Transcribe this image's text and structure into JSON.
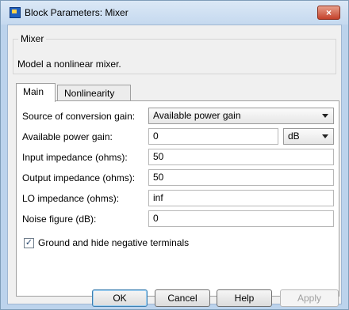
{
  "window": {
    "title": "Block Parameters: Mixer",
    "close_glyph": "×"
  },
  "group": {
    "legend": "Mixer",
    "description": "Model a nonlinear mixer."
  },
  "tabs": [
    {
      "label": "Main"
    },
    {
      "label": "Nonlinearity"
    }
  ],
  "main": {
    "source_gain": {
      "label": "Source of conversion gain:",
      "value": "Available power gain"
    },
    "available_power_gain": {
      "label": "Available power gain:",
      "value": "0",
      "unit": "dB"
    },
    "input_impedance": {
      "label": "Input impedance (ohms):",
      "value": "50"
    },
    "output_impedance": {
      "label": "Output impedance (ohms):",
      "value": "50"
    },
    "lo_impedance": {
      "label": "LO impedance (ohms):",
      "value": "inf"
    },
    "noise_figure": {
      "label": "Noise figure (dB):",
      "value": "0"
    },
    "ground_checkbox": {
      "label": "Ground and hide negative terminals",
      "checked": true,
      "glyph": "✓"
    }
  },
  "buttons": {
    "ok": "OK",
    "cancel": "Cancel",
    "help": "Help",
    "apply": "Apply"
  }
}
